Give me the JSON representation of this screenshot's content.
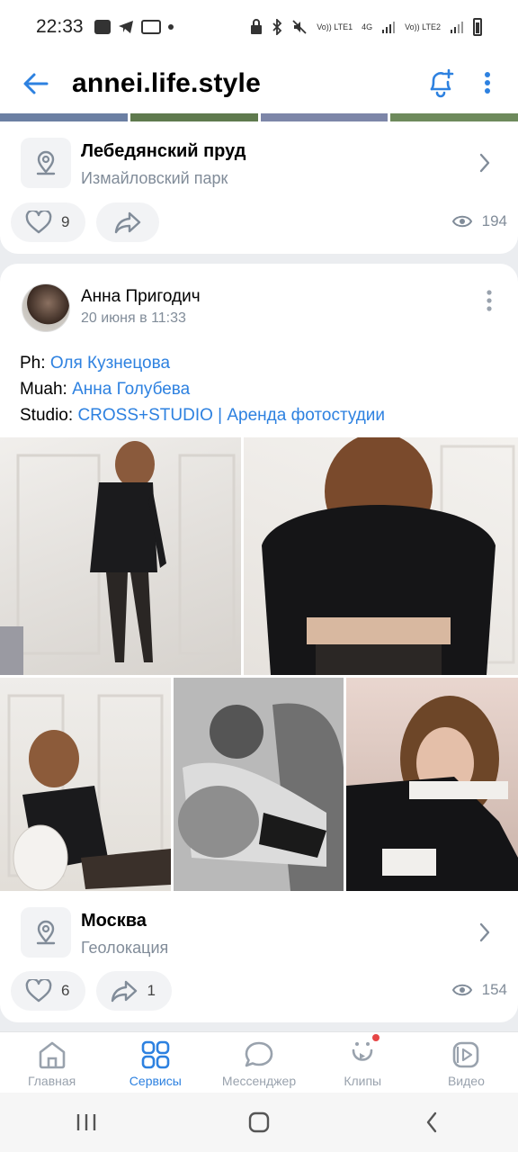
{
  "status_bar": {
    "time": "22:33",
    "net1": "Vo)) LTE1",
    "net_type": "4G",
    "net2": "Vo)) LTE2"
  },
  "header": {
    "title": "annei.life.style"
  },
  "card1": {
    "place_title": "Лебедянский пруд",
    "place_subtitle": "Измайловский парк",
    "likes": "9",
    "views": "194"
  },
  "post": {
    "author": "Анна Пригодич",
    "date": "20 июня в 11:33",
    "lines": [
      {
        "prefix": "Ph: ",
        "link": "Оля Кузнецова"
      },
      {
        "prefix": "Muah: ",
        "link": "Анна Голубева"
      },
      {
        "prefix": "Studio: ",
        "link": "CROSS+STUDIO | Аренда фотостудии"
      }
    ],
    "geo_title": "Москва",
    "geo_subtitle": "Геолокация",
    "likes": "6",
    "shares": "1",
    "views": "154"
  },
  "bottom_nav": [
    {
      "label": "Главная",
      "icon": "home-icon",
      "active": false
    },
    {
      "label": "Сервисы",
      "icon": "services-icon",
      "active": true
    },
    {
      "label": "Мессенджер",
      "icon": "messenger-icon",
      "active": false
    },
    {
      "label": "Клипы",
      "icon": "clips-icon",
      "active": false
    },
    {
      "label": "Видео",
      "icon": "video-icon",
      "active": false
    }
  ],
  "colors": {
    "accent": "#2d81e0",
    "secondary_text": "#818c99",
    "background": "#ebedf0"
  }
}
